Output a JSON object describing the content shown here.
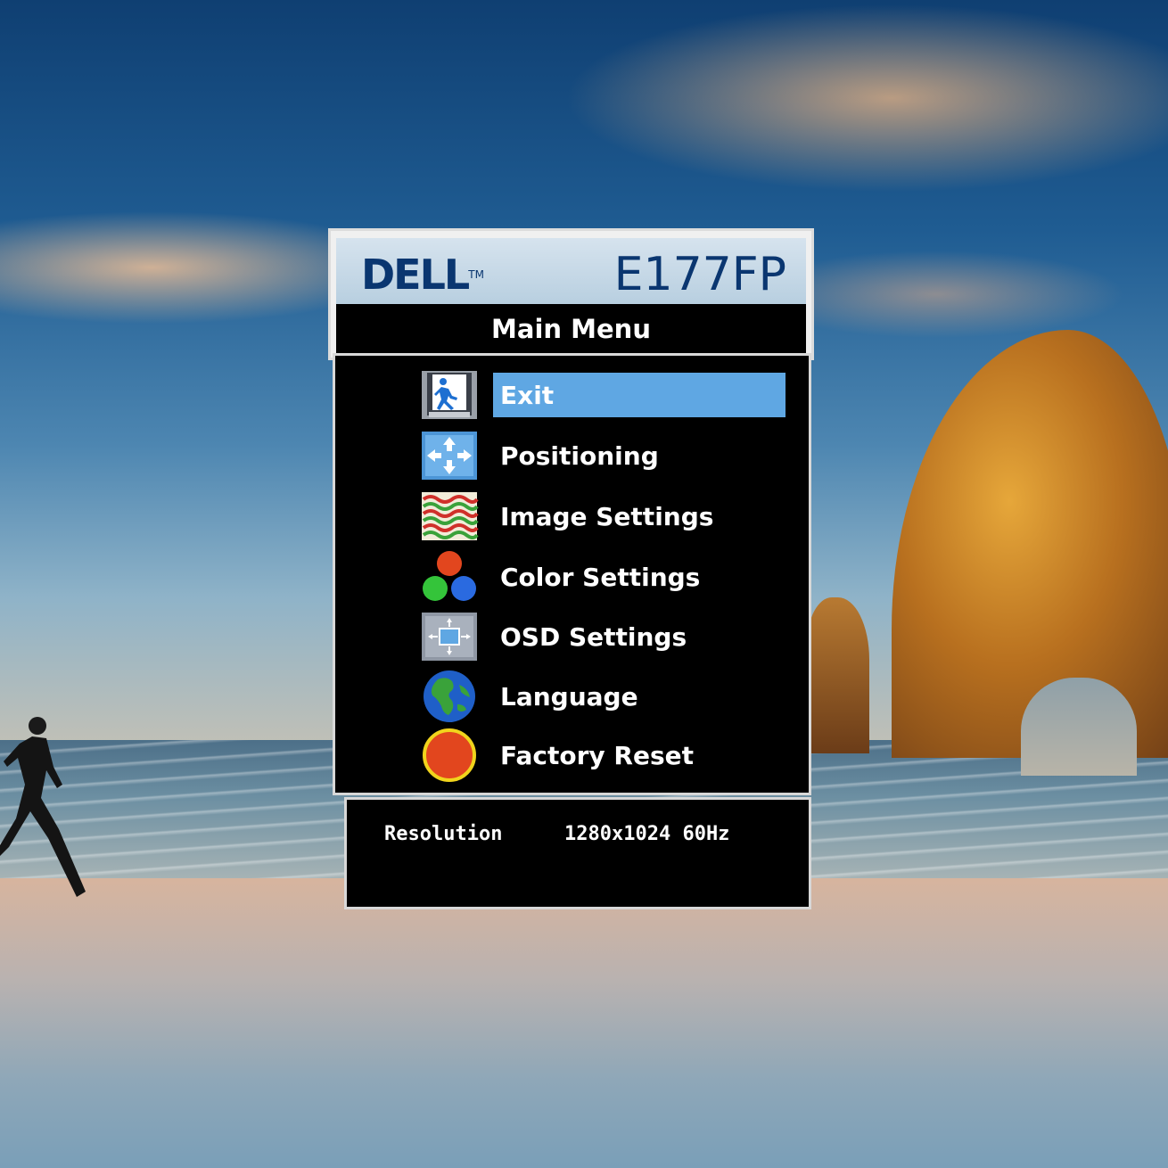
{
  "osd": {
    "brand": "DELL",
    "trademark": "TM",
    "model": "E177FP",
    "menu_title": "Main Menu",
    "items": [
      {
        "label": "Exit",
        "icon": "exit-icon",
        "selected": true
      },
      {
        "label": "Positioning",
        "icon": "positioning-icon",
        "selected": false
      },
      {
        "label": "Image Settings",
        "icon": "image-settings-icon",
        "selected": false
      },
      {
        "label": "Color Settings",
        "icon": "color-settings-icon",
        "selected": false
      },
      {
        "label": "OSD Settings",
        "icon": "osd-settings-icon",
        "selected": false
      },
      {
        "label": "Language",
        "icon": "globe-icon",
        "selected": false
      },
      {
        "label": "Factory Reset",
        "icon": "factory-reset-icon",
        "selected": false
      }
    ],
    "resolution_label": "Resolution",
    "resolution_value": "1280x1024 60Hz"
  },
  "colors": {
    "brand_blue": "#0a3670",
    "selection_blue": "#5fa7e3",
    "osd_background": "#000000"
  }
}
